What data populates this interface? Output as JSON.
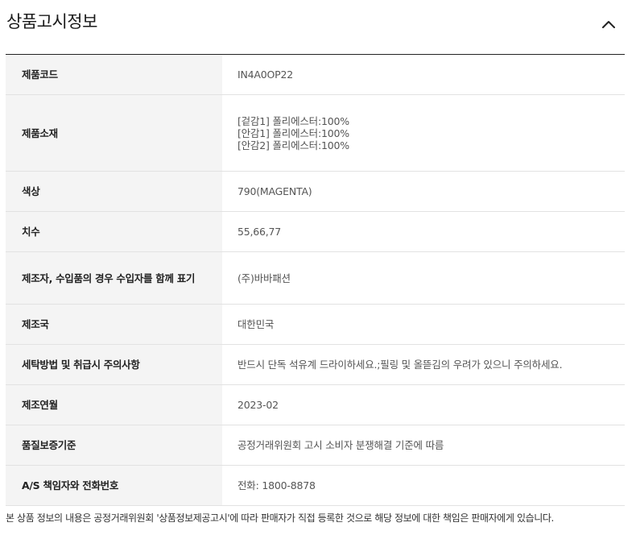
{
  "section": {
    "title": "상품고시정보",
    "toggle_icon": "chevron-up-icon"
  },
  "rows": [
    {
      "label": "제품코드",
      "values": [
        "IN4A0OP22"
      ]
    },
    {
      "label": "제품소재",
      "values": [
        "[겉감1] 폴리에스터:100%",
        "[안감1] 폴리에스터:100%",
        "[안감2] 폴리에스터:100%"
      ]
    },
    {
      "label": "색상",
      "values": [
        "790(MAGENTA)"
      ]
    },
    {
      "label": "치수",
      "values": [
        "55,66,77"
      ]
    },
    {
      "label": "제조자, 수입품의 경우 수입자를 함께 표기",
      "values": [
        "(주)바바패션"
      ]
    },
    {
      "label": "제조국",
      "values": [
        "대한민국"
      ]
    },
    {
      "label": "세탁방법 및 취급시 주의사항",
      "values": [
        "반드시 단독 석유계 드라이하세요.;필링 및 올뜯김의 우려가 있으니 주의하세요."
      ]
    },
    {
      "label": "제조연월",
      "values": [
        "2023-02"
      ]
    },
    {
      "label": "품질보증기준",
      "values": [
        "공정거래위원회 고시 소비자 분쟁해결 기준에 따름"
      ]
    },
    {
      "label": "A/S 책임자와 전화번호",
      "values": [
        "전화: 1800-8878"
      ]
    }
  ],
  "footnote": "본 상품 정보의 내용은 공정거래위원회 '상품정보제공고시'에 따라 판매자가 직접 등록한 것으로 해당 정보에 대한 책임은 판매자에게 있습니다."
}
